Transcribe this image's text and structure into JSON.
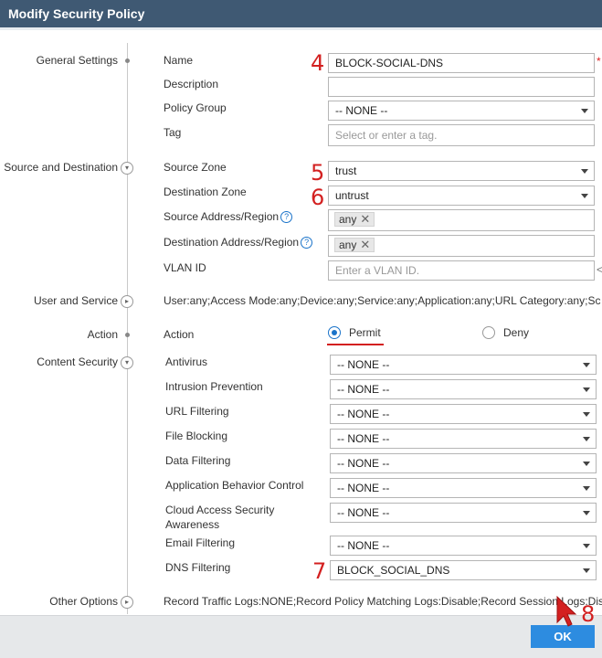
{
  "dialog": {
    "title": "Modify Security Policy"
  },
  "sections": {
    "general": "General Settings",
    "source_dest": "Source and Destination",
    "user_service": "User and Service",
    "action": "Action",
    "content_security": "Content Security",
    "other_options": "Other Options"
  },
  "general": {
    "name_label": "Name",
    "name_value": "BLOCK-SOCIAL-DNS",
    "name_required": "*",
    "description_label": "Description",
    "description_value": "",
    "policy_group_label": "Policy Group",
    "policy_group_value": "-- NONE --",
    "tag_label": "Tag",
    "tag_placeholder": "Select or enter a tag."
  },
  "source_dest": {
    "source_zone_label": "Source Zone",
    "source_zone_value": "trust",
    "dest_zone_label": "Destination Zone",
    "dest_zone_value": "untrust",
    "source_addr_label": "Source Address/Region",
    "source_addr_tag": "any",
    "dest_addr_label": "Destination Address/Region",
    "dest_addr_tag": "any",
    "vlan_label": "VLAN ID",
    "vlan_placeholder": "Enter a VLAN ID.",
    "vlan_overflow": "<"
  },
  "user_service": {
    "summary": "User:any;Access Mode:any;Device:any;Service:any;Application:any;URL Category:any;Sc"
  },
  "action": {
    "label": "Action",
    "permit": "Permit",
    "deny": "Deny",
    "selected": "Permit"
  },
  "content_security": {
    "items": [
      {
        "label": "Antivirus",
        "value": "-- NONE --"
      },
      {
        "label": "Intrusion Prevention",
        "value": "-- NONE --"
      },
      {
        "label": "URL Filtering",
        "value": "-- NONE --"
      },
      {
        "label": "File Blocking",
        "value": "-- NONE --"
      },
      {
        "label": "Data Filtering",
        "value": "-- NONE --"
      },
      {
        "label": "Application Behavior Control",
        "value": "-- NONE --"
      },
      {
        "label": "Cloud Access Security",
        "label2": "Awareness",
        "value": "-- NONE --"
      },
      {
        "label": "Email Filtering",
        "value": "-- NONE --"
      },
      {
        "label": "DNS Filtering",
        "value": "BLOCK_SOCIAL_DNS"
      }
    ]
  },
  "other_options": {
    "summary": "Record Traffic Logs:NONE;Record Policy Matching Logs:Disable;Record Session Logs:Dis"
  },
  "footer": {
    "ok_label": "OK"
  },
  "annotations": {
    "step4": "4",
    "step5": "5",
    "step6": "6",
    "step7": "7",
    "step8": "8"
  },
  "colors": {
    "title_bar": "#3f5973",
    "annotation_red": "#d32020",
    "primary_button": "#2d8ce0",
    "help_icon": "#1a73c9"
  },
  "icons": {
    "section_marker": "dot",
    "section_toggle": "chevron-down-circle-icon",
    "help": "question-circle-icon",
    "remove_tag": "close-icon",
    "dropdown": "caret-down-icon",
    "cursor": "red-arrow-cursor-icon"
  }
}
